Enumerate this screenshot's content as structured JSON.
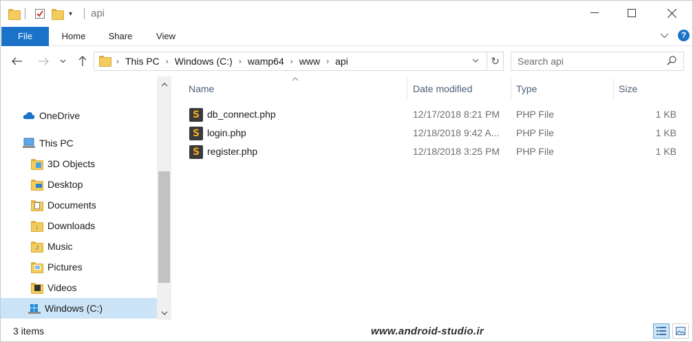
{
  "window": {
    "title": "api",
    "accent_color": "#1a73c8",
    "selection_color": "#cce4f7"
  },
  "ribbon": {
    "tabs": [
      "File",
      "Home",
      "Share",
      "View"
    ]
  },
  "address": {
    "breadcrumbs": [
      "This PC",
      "Windows (C:)",
      "wamp64",
      "www",
      "api"
    ],
    "search_placeholder": "Search api"
  },
  "navigation": {
    "items": [
      {
        "label": "OneDrive",
        "icon": "onedrive-icon"
      },
      {
        "label": "This PC",
        "icon": "computer-icon"
      },
      {
        "label": "3D Objects",
        "icon": "3d-objects-folder-icon"
      },
      {
        "label": "Desktop",
        "icon": "desktop-folder-icon"
      },
      {
        "label": "Documents",
        "icon": "documents-folder-icon"
      },
      {
        "label": "Downloads",
        "icon": "downloads-folder-icon"
      },
      {
        "label": "Music",
        "icon": "music-folder-icon"
      },
      {
        "label": "Pictures",
        "icon": "pictures-folder-icon"
      },
      {
        "label": "Videos",
        "icon": "videos-folder-icon"
      },
      {
        "label": "Windows (C:)",
        "icon": "drive-icon",
        "selected": true
      }
    ]
  },
  "files": {
    "columns": [
      "Name",
      "Date modified",
      "Type",
      "Size"
    ],
    "rows": [
      {
        "name": "db_connect.php",
        "date": "12/17/2018 8:21 PM",
        "type": "PHP File",
        "size": "1 KB"
      },
      {
        "name": "login.php",
        "date": "12/18/2018 9:42 A...",
        "type": "PHP File",
        "size": "1 KB"
      },
      {
        "name": "register.php",
        "date": "12/18/2018 3:25 PM",
        "type": "PHP File",
        "size": "1 KB"
      }
    ]
  },
  "status": {
    "item_count": "3 items",
    "watermark": "www.android-studio.ir"
  }
}
